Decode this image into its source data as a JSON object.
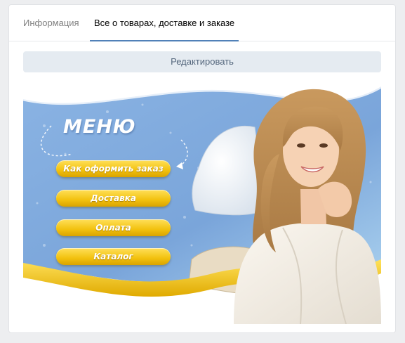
{
  "tabs": [
    {
      "label": "Информация",
      "active": false
    },
    {
      "label": "Все о товарах, доставке и заказе",
      "active": true
    }
  ],
  "edit_button": {
    "label": "Редактировать"
  },
  "banner": {
    "title": "МЕНЮ",
    "buttons": [
      {
        "label": "Как оформить заказ"
      },
      {
        "label": "Доставка"
      },
      {
        "label": "Оплата"
      },
      {
        "label": "Каталог"
      }
    ]
  },
  "colors": {
    "accent": "#5181b8",
    "edit_button_bg": "#e5ebf1",
    "banner_sky": "#7fa9dc",
    "menu_button": "#f2c10e"
  }
}
